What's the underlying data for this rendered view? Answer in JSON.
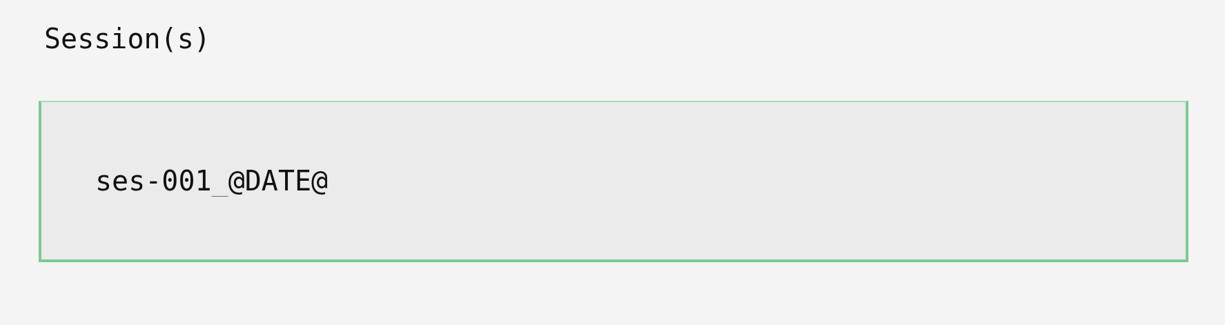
{
  "label": "Session(s)",
  "field": {
    "value": "ses-001_@DATE@"
  }
}
